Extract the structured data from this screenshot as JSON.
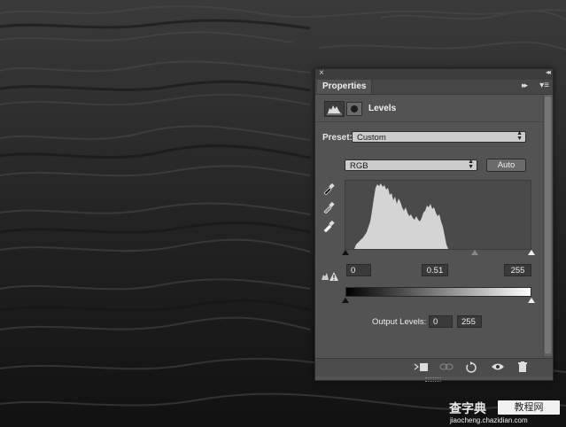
{
  "panel": {
    "close_glyph": "×",
    "collapse_glyph": "◂◂",
    "tab_label": "Properties",
    "more_glyph": "▸▸",
    "menu_glyph": "▾≡",
    "layer_title": "Levels"
  },
  "preset": {
    "label": "Preset:",
    "value": "Custom"
  },
  "channel": {
    "value": "RGB",
    "auto_label": "Auto"
  },
  "input_levels": {
    "black": "0",
    "gamma": "0.51",
    "white": "255"
  },
  "output_levels": {
    "label": "Output Levels:",
    "black": "0",
    "white": "255"
  },
  "icons": {
    "close": "close-icon",
    "eyedropper_black": "eyedropper-black-icon",
    "eyedropper_gray": "eyedropper-gray-icon",
    "eyedropper_white": "eyedropper-white-icon",
    "clip": "clip-to-layer-icon",
    "view_previous": "view-previous-icon",
    "reset": "reset-icon",
    "visibility": "eye-icon",
    "delete": "trash-icon",
    "warning": "warning-icon"
  },
  "watermark": {
    "cn_site": "查字典",
    "cn_tag": "教程网",
    "url": "jiaocheng.chazidian.com"
  },
  "colors": {
    "panel_bg": "#535353",
    "histogram_fill": "#d4d4d4",
    "water": "#222222"
  }
}
